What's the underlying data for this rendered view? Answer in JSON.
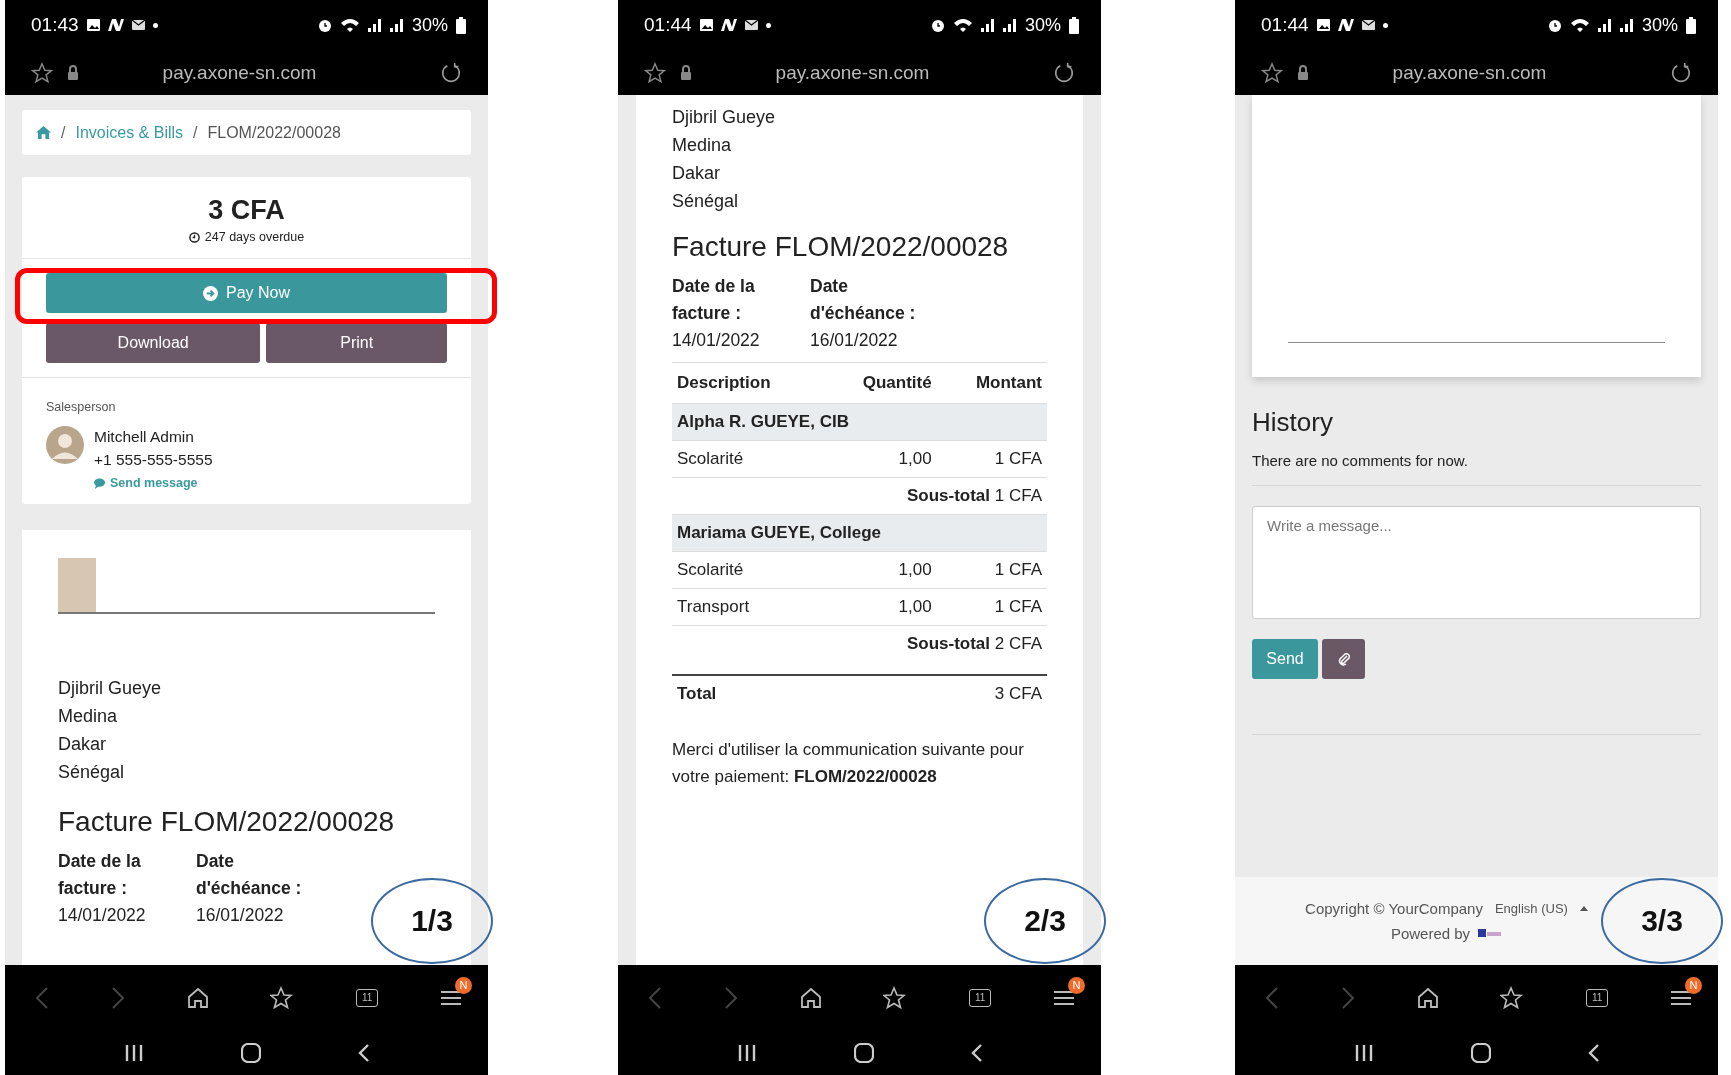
{
  "phones": [
    {
      "kind": "summary",
      "time": "01:43",
      "battery": "30%",
      "url": "pay.axone-sn.com",
      "tab_count": "11",
      "badge": "N",
      "page_label": "1/3",
      "breadcrumb": [
        "Invoices & Bills",
        "FLOM/2022/00028"
      ],
      "breadcrumb_separator": "/",
      "amount": "3 CFA",
      "overdue": "247 days overdue",
      "pay_button": "Pay Now",
      "buttons": [
        "Download",
        "Print"
      ],
      "salesperson_label": "Salesperson",
      "salesperson_name": "Mitchell Admin",
      "salesperson_phone": "+1 555-555-5555",
      "send_message": "Send message",
      "address": [
        "Djibril Gueye",
        "Medina",
        "Dakar",
        "Sénégal"
      ],
      "invoice_title": "Facture FLOM/2022/00028",
      "dates": [
        {
          "label": "Date de la facture :",
          "value": "14/01/2022"
        },
        {
          "label": "Date d'échéance :",
          "value": "16/01/2022"
        }
      ]
    },
    {
      "kind": "invoice",
      "time": "01:44",
      "battery": "30%",
      "url": "pay.axone-sn.com",
      "tab_count": "11",
      "badge": "N",
      "page_label": "2/3",
      "address": [
        "Djibril Gueye",
        "Medina",
        "Dakar",
        "Sénégal"
      ],
      "invoice_title": "Facture FLOM/2022/00028",
      "dates": [
        {
          "label": "Date de la facture :",
          "value": "14/01/2022"
        },
        {
          "label": "Date d'échéance :",
          "value": "16/01/2022"
        }
      ],
      "columns": [
        "Description",
        "Quantité",
        "Montant"
      ],
      "rows": [
        {
          "kind": "section",
          "label": "Alpha R. GUEYE, CIB"
        },
        {
          "kind": "line",
          "description": "Scolarité",
          "quantity": "1,00",
          "amount": "1 CFA"
        },
        {
          "kind": "subtotal",
          "label": "Sous-total",
          "amount": "1 CFA"
        },
        {
          "kind": "section",
          "label": "Mariama GUEYE, College"
        },
        {
          "kind": "line",
          "description": "Scolarité",
          "quantity": "1,00",
          "amount": "1 CFA"
        },
        {
          "kind": "line",
          "description": "Transport",
          "quantity": "1,00",
          "amount": "1 CFA"
        },
        {
          "kind": "subtotal",
          "label": "Sous-total",
          "amount": "2 CFA"
        },
        {
          "kind": "total",
          "label": "Total",
          "amount": "3 CFA"
        }
      ],
      "note": "Merci d'utiliser la communication suivante pour votre paiement: **FLOM/2022/00028**"
    },
    {
      "kind": "history",
      "time": "01:44",
      "battery": "30%",
      "url": "pay.axone-sn.com",
      "tab_count": "11",
      "badge": "N",
      "page_label": "3/3",
      "history_title": "History",
      "no_comments": "There are no comments for now.",
      "message_placeholder": "Write a message...",
      "send_button": "Send",
      "copyright": "Copyright © YourCompany",
      "language": "English (US)",
      "powered_by": "Powered by"
    }
  ]
}
